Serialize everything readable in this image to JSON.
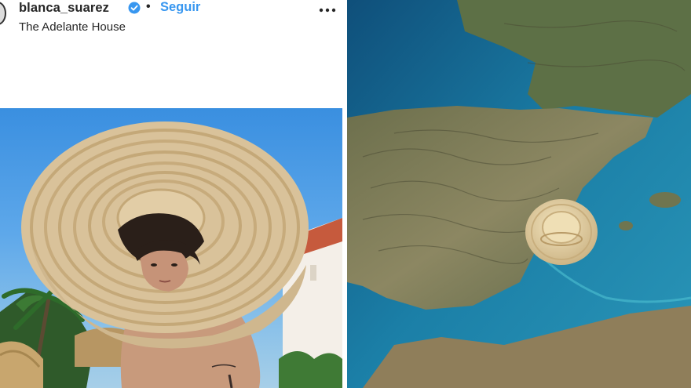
{
  "post": {
    "username": "blanca_suarez",
    "separator": "•",
    "follow_label": "Seguir",
    "location": "The Adelante House",
    "icons": {
      "verified": "verified-badge-icon",
      "more": "more-options-icon",
      "avatar": "profile-avatar"
    },
    "colors": {
      "follow": "#3897f0",
      "verified": "#3897f0",
      "text": "#262626"
    }
  },
  "map": {
    "description_icon": "straw-hat-over-spain-map"
  }
}
